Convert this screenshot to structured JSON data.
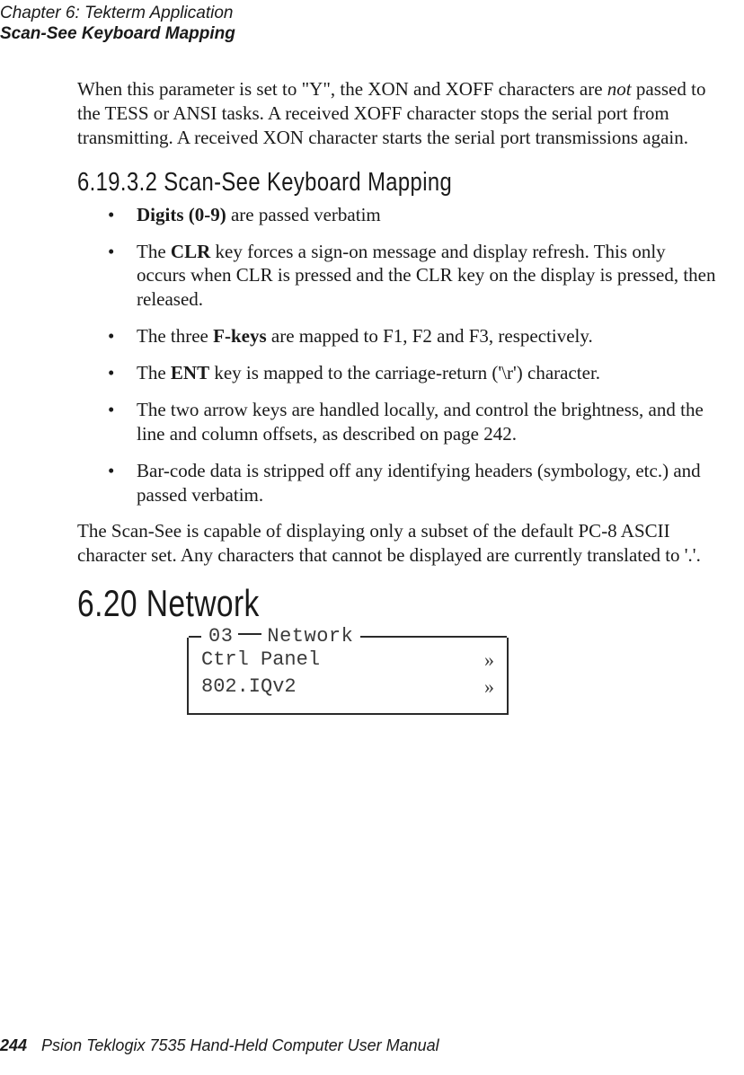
{
  "header": {
    "line1": "Chapter 6: Tekterm Application",
    "line2": "Scan-See Keyboard Mapping"
  },
  "intro": {
    "pre": "When this parameter is set to \"Y\", the XON and XOFF characters are ",
    "not_word": "not",
    "post": " passed to the TESS or ANSI tasks. A received XOFF character stops the serial port from transmitting. A received XON character starts the serial port transmissions again."
  },
  "section_6_19_3_2": {
    "heading": "6.19.3.2  Scan-See Keyboard Mapping",
    "bullets": [
      {
        "b": "Digits (0-9)",
        "rest": " are passed verbatim"
      },
      {
        "pre": "The ",
        "b": "CLR",
        "rest": " key forces a sign-on message and display refresh. This only occurs when CLR is pressed and the CLR key on the display is pressed, then released."
      },
      {
        "pre": "The three ",
        "b": "F-keys",
        "rest": " are mapped to F1, F2 and F3, respectively."
      },
      {
        "pre": "The ",
        "b": "ENT",
        "rest": " key is mapped to the carriage-return ('\\r') character."
      },
      {
        "rest": "The two arrow keys are handled locally, and control the brightness, and the line and column offsets, as described on page 242."
      },
      {
        "rest": "Bar-code data is stripped off any identifying headers (symbology, etc.) and passed verbatim."
      }
    ],
    "after": "The Scan-See is capable of displaying only a subset of the default PC-8 ASCII character set. Any characters that cannot be displayed are currently translated to '.'."
  },
  "section_6_20": {
    "heading": "6.20  Network",
    "figure": {
      "title_left": "03",
      "title_right": "Network",
      "rows": [
        {
          "label": "Ctrl Panel",
          "arrow": "»"
        },
        {
          "label": "802.IQv2",
          "arrow": "»"
        }
      ]
    }
  },
  "footer": {
    "page": "244",
    "text": "Psion Teklogix 7535 Hand-Held Computer User Manual"
  }
}
